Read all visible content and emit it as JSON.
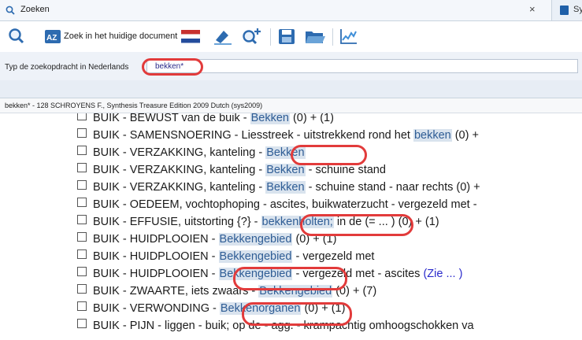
{
  "tabs": [
    {
      "title": "Zoeken",
      "close": "×"
    },
    {
      "title": "Sy"
    }
  ],
  "toolbar": {
    "search_scope_label": "Zoek in het huidige document"
  },
  "query": {
    "label": "Typ de zoekopdracht in Nederlands",
    "value": "bekken*"
  },
  "info": {
    "text": "bekken* - 128  SCHROYENS F., Synthesis Treasure Edition 2009 Dutch (sys2009)"
  },
  "results": [
    {
      "pre": "BUIK - BEWUST van de buik - ",
      "hl": "Bekken",
      "post": " (0)  + (1)",
      "link": ""
    },
    {
      "pre": "BUIK - SAMENSNOERING - Liesstreek - uitstrekkend rond het ",
      "hl": "bekken",
      "post": " (0)  +",
      "link": ""
    },
    {
      "pre": "BUIK - VERZAKKING, kanteling - ",
      "hl": "Bekken",
      "post": "",
      "link": ""
    },
    {
      "pre": "BUIK - VERZAKKING, kanteling - ",
      "hl": "Bekken",
      "post": " - schuine stand",
      "link": ""
    },
    {
      "pre": "BUIK - VERZAKKING, kanteling - ",
      "hl": "Bekken",
      "post": " - schuine stand - naar rechts (0)  +",
      "link": ""
    },
    {
      "pre": "BUIK - OEDEEM, vochtophoping - ascites, buikwaterzucht - vergezeld met -",
      "hl": "",
      "post": "",
      "link": ""
    },
    {
      "pre": "BUIK - EFFUSIE, uitstorting {?} - ",
      "hl": "bekkenholten;",
      "post": " in de (= ... ) (0)  + (1)",
      "link": ""
    },
    {
      "pre": "BUIK - HUIDPLOOIEN - ",
      "hl": "Bekkengebied",
      "post": " (0)  + (1)",
      "link": ""
    },
    {
      "pre": "BUIK - HUIDPLOOIEN - ",
      "hl": "Bekkengebied",
      "post": " - vergezeld met",
      "link": ""
    },
    {
      "pre": "BUIK - HUIDPLOOIEN - ",
      "hl": "Bekkengebied",
      "post": " - vergezeld met - ascites ",
      "link": "(Zie ... )"
    },
    {
      "pre": "BUIK - ZWAARTE, iets zwaars - ",
      "hl": "Bekkengebied",
      "post": " (0)  + (7)",
      "link": ""
    },
    {
      "pre": "BUIK - VERWONDING - ",
      "hl": "Bekkenorganen",
      "post": " (0)  + (1)",
      "link": ""
    },
    {
      "pre": "BUIK - PIJN - liggen - buik; op de - agg. - krampachtig omhoogschokken va",
      "hl": "",
      "post": "",
      "link": ""
    }
  ],
  "colors": {
    "highlight_bg": "#d9e3ee",
    "highlight_text": "#2f5d95",
    "annotation": "#e23b3b"
  }
}
